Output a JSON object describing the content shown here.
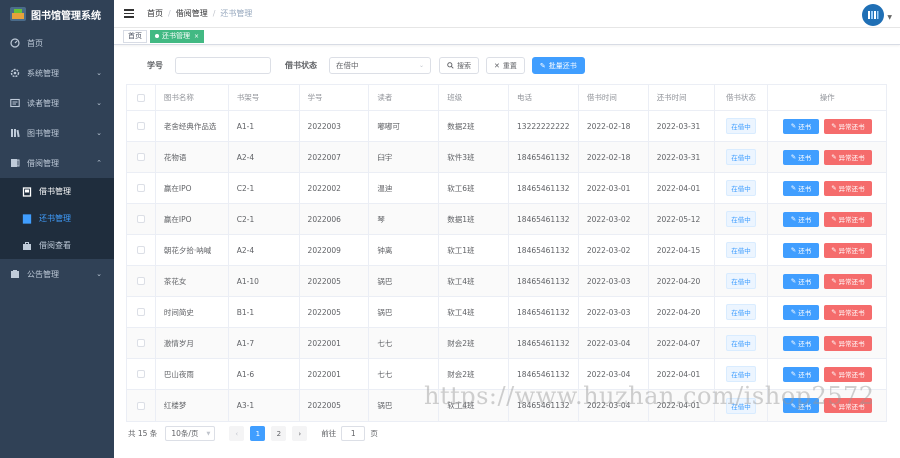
{
  "app": {
    "title": "图书馆管理系统"
  },
  "sidebar": {
    "items": [
      {
        "label": "首页",
        "icon": "dashboard-icon"
      },
      {
        "label": "系统管理",
        "icon": "gear-icon",
        "has_arrow": true
      },
      {
        "label": "读者管理",
        "icon": "reader-icon",
        "has_arrow": true
      },
      {
        "label": "图书管理",
        "icon": "books-icon",
        "has_arrow": true
      },
      {
        "label": "借阅管理",
        "icon": "borrow-icon",
        "has_arrow": true,
        "expanded": true
      }
    ],
    "subitems": [
      {
        "label": "借书管理",
        "icon": "book-icon"
      },
      {
        "label": "还书管理",
        "icon": "return-icon",
        "active": true
      },
      {
        "label": "借阅查看",
        "icon": "briefcase-icon"
      }
    ],
    "footer_item": {
      "label": "公告管理",
      "icon": "notice-icon"
    }
  },
  "header": {
    "breadcrumb": [
      "首页",
      "借阅管理",
      "还书管理"
    ]
  },
  "tags": [
    {
      "label": "首页",
      "active": false
    },
    {
      "label": "还书管理",
      "active": true,
      "close": "×"
    }
  ],
  "filter": {
    "student_label": "学号",
    "student_value": "",
    "status_label": "借书状态",
    "status_value": "在借中",
    "search_label": "搜索",
    "reset_label": "重置",
    "batch_label": "批量还书"
  },
  "table": {
    "columns": [
      "图书名称",
      "书架号",
      "学号",
      "读者",
      "班级",
      "电话",
      "借书时间",
      "还书时间",
      "借书状态",
      "操作"
    ],
    "status_text": "在借中",
    "return_label": "还书",
    "abnormal_label": "异常还书",
    "rows": [
      {
        "title": "老舍经典作品选",
        "shelf": "A1-1",
        "sid": "2022003",
        "reader": "嘟嘟可",
        "cls": "数据2班",
        "phone": "13222222222",
        "borrow": "2022-02-18",
        "due": "2022-03-31"
      },
      {
        "title": "花物语",
        "shelf": "A2-4",
        "sid": "2022007",
        "reader": "臼宇",
        "cls": "软件3班",
        "phone": "18465461132",
        "borrow": "2022-02-18",
        "due": "2022-03-31"
      },
      {
        "title": "赢在IPO",
        "shelf": "C2-1",
        "sid": "2022002",
        "reader": "温迪",
        "cls": "软工6班",
        "phone": "18465461132",
        "borrow": "2022-03-01",
        "due": "2022-04-01"
      },
      {
        "title": "赢在IPO",
        "shelf": "C2-1",
        "sid": "2022006",
        "reader": "琴",
        "cls": "数据1班",
        "phone": "18465461132",
        "borrow": "2022-03-02",
        "due": "2022-05-12"
      },
      {
        "title": "朝花夕拾·呐喊",
        "shelf": "A2-4",
        "sid": "2022009",
        "reader": "钟离",
        "cls": "软工1班",
        "phone": "18465461132",
        "borrow": "2022-03-02",
        "due": "2022-04-15"
      },
      {
        "title": "茶花女",
        "shelf": "A1-10",
        "sid": "2022005",
        "reader": "锅巴",
        "cls": "软工4班",
        "phone": "18465461132",
        "borrow": "2022-03-03",
        "due": "2022-04-20"
      },
      {
        "title": "时间简史",
        "shelf": "B1-1",
        "sid": "2022005",
        "reader": "锅巴",
        "cls": "软工4班",
        "phone": "18465461132",
        "borrow": "2022-03-03",
        "due": "2022-04-20"
      },
      {
        "title": "激情岁月",
        "shelf": "A1-7",
        "sid": "2022001",
        "reader": "七七",
        "cls": "财会2班",
        "phone": "18465461132",
        "borrow": "2022-03-04",
        "due": "2022-04-07"
      },
      {
        "title": "巴山夜雨",
        "shelf": "A1-6",
        "sid": "2022001",
        "reader": "七七",
        "cls": "财会2班",
        "phone": "18465461132",
        "borrow": "2022-03-04",
        "due": "2022-04-01"
      },
      {
        "title": "红楼梦",
        "shelf": "A3-1",
        "sid": "2022005",
        "reader": "锅巴",
        "cls": "软工4班",
        "phone": "18465461132",
        "borrow": "2022-03-04",
        "due": "2022-04-01"
      }
    ]
  },
  "pagination": {
    "total_text": "共 15 条",
    "page_size": "10条/页",
    "pages": [
      "1",
      "2"
    ],
    "current_page": "1",
    "prev": "‹",
    "next": "›",
    "goto_prefix": "前往",
    "goto_value": "1",
    "goto_suffix": "页"
  },
  "watermark": "https://www.huzhan.com/ishop2572",
  "colors": {
    "sidebar_bg": "#304156",
    "sidebar_sub_bg": "#1f2d3d",
    "primary": "#409eff",
    "danger": "#f56c6c",
    "tag_active": "#42b983"
  }
}
